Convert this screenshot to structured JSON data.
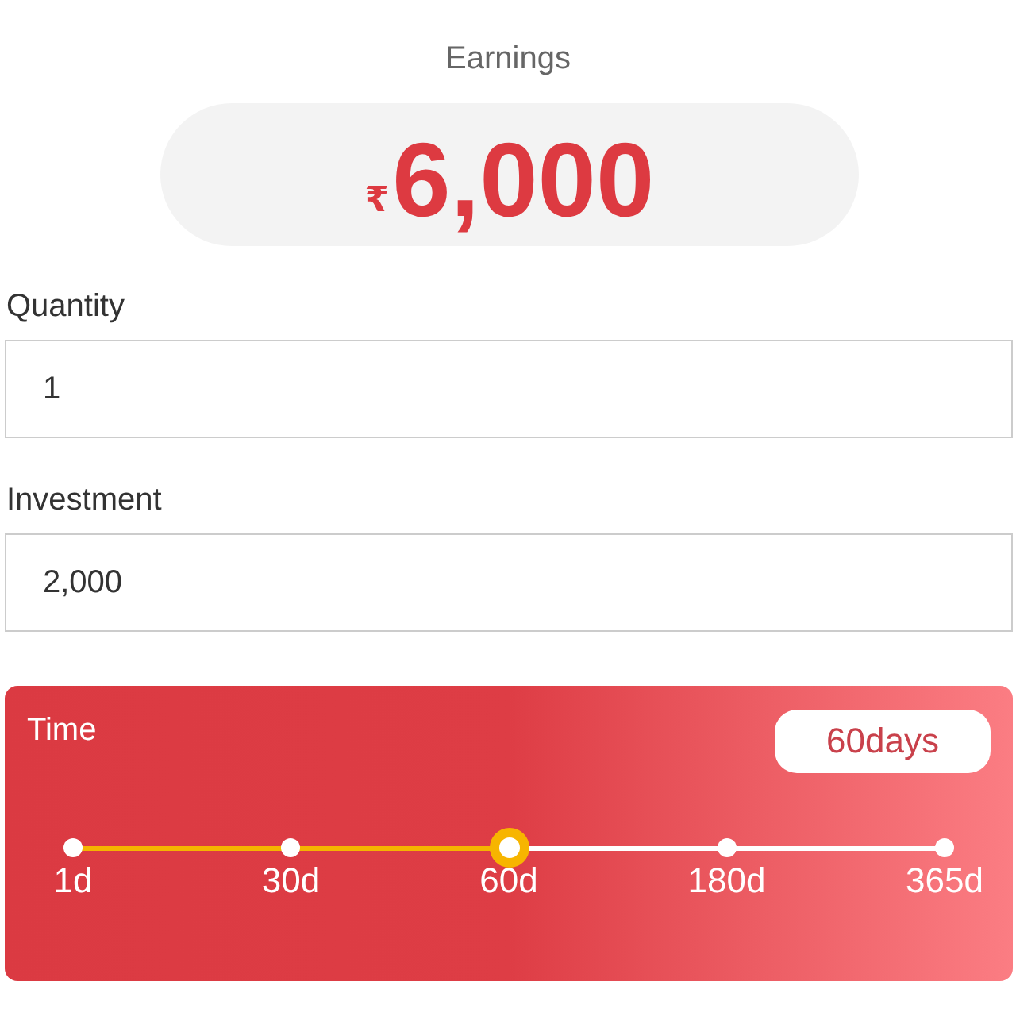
{
  "earnings": {
    "label": "Earnings",
    "currency": "₹",
    "amount": "6,000"
  },
  "fields": [
    {
      "label": "Quantity",
      "value": "1"
    },
    {
      "label": "Investment",
      "value": "2,000"
    }
  ],
  "time": {
    "label": "Time",
    "badge": "60days",
    "level": 0.5,
    "stops": [
      {
        "label": "1d",
        "selected": false
      },
      {
        "label": "30d",
        "selected": false
      },
      {
        "label": "60d",
        "selected": true
      },
      {
        "label": "180d",
        "selected": false
      },
      {
        "label": "365d",
        "selected": false
      }
    ]
  }
}
